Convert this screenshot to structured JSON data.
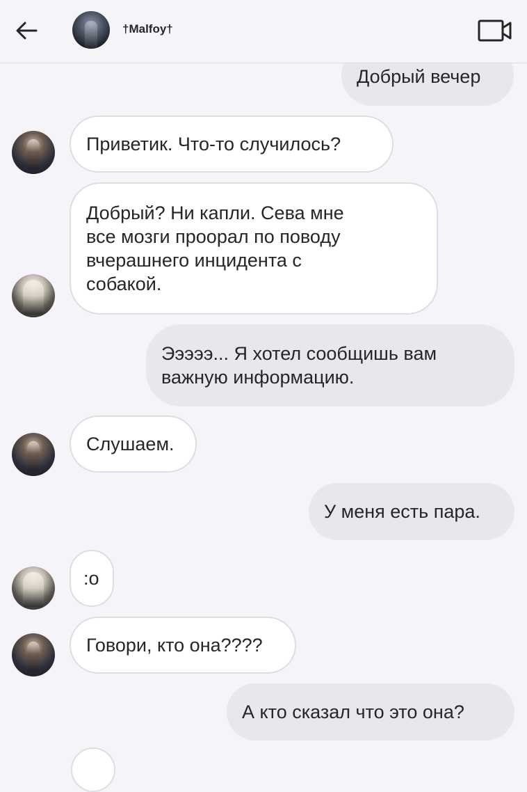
{
  "header": {
    "contact_name": "†Malfoy†",
    "back_icon": "arrow-left-icon",
    "video_icon": "video-camera-icon"
  },
  "messages": [
    {
      "side": "out",
      "text": "Добрый вечер"
    },
    {
      "side": "in",
      "avatar": "a",
      "text": "Приветик. Что-то случилось?"
    },
    {
      "side": "in",
      "avatar": "b",
      "lines": [
        "Добрый? Ни капли. Сева мне",
        "все мозги проорал по поводу",
        "вчерашнего инцидента с",
        "собакой."
      ]
    },
    {
      "side": "out",
      "lines": [
        "Эээээ... Я хотел сообщишь вам",
        "важную информацию."
      ]
    },
    {
      "side": "in",
      "avatar": "a",
      "text": "Слушаем."
    },
    {
      "side": "out",
      "text": "У меня есть пара."
    },
    {
      "side": "in",
      "avatar": "b",
      "text": ":о"
    },
    {
      "side": "in",
      "avatar": "a",
      "text": "Говори, кто она????"
    },
    {
      "side": "out",
      "text": "А кто сказал что это она?"
    }
  ],
  "colors": {
    "background": "#f5f4f8",
    "incoming_bubble": "#ffffff",
    "outgoing_bubble": "#e8e7ec",
    "text": "#262626"
  }
}
